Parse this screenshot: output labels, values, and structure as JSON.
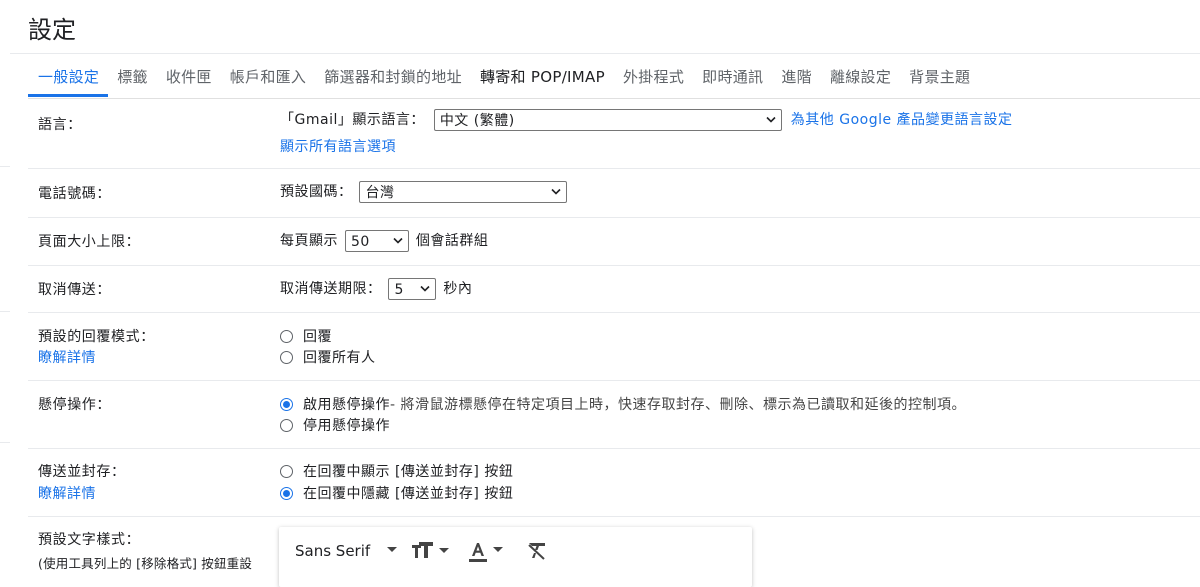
{
  "page": {
    "title": "設定"
  },
  "tabs": [
    {
      "label": "一般設定",
      "active": true
    },
    {
      "label": "標籤"
    },
    {
      "label": "收件匣"
    },
    {
      "label": "帳戶和匯入"
    },
    {
      "label": "篩選器和封鎖的地址"
    },
    {
      "label": "轉寄和 POP/IMAP",
      "plain": true
    },
    {
      "label": "外掛程式"
    },
    {
      "label": "即時通訊"
    },
    {
      "label": "進階"
    },
    {
      "label": "離線設定"
    },
    {
      "label": "背景主題"
    }
  ],
  "language": {
    "label": "語言：",
    "display_label": "「Gmail」顯示語言：",
    "value": "中文 (繁體)",
    "other_products_link": "為其他 Google 產品變更語言設定",
    "show_all_link": "顯示所有語言選項"
  },
  "phone": {
    "label": "電話號碼：",
    "country_label": "預設國碼：",
    "value": "台灣"
  },
  "page_size": {
    "label": "頁面大小上限：",
    "prefix": "每頁顯示",
    "value": "50",
    "suffix": "個會話群組"
  },
  "undo_send": {
    "label": "取消傳送：",
    "prefix": "取消傳送期限：",
    "value": "5",
    "suffix": "秒內"
  },
  "reply": {
    "label": "預設的回覆模式：",
    "learn_more": "瞭解詳情",
    "options": [
      "回覆",
      "回覆所有人"
    ],
    "selected": 0
  },
  "hover": {
    "label": "懸停操作：",
    "enable": "啟用懸停操作",
    "enable_desc": " - 將滑鼠游標懸停在特定項目上時，快速存取封存、刪除、標示為已讀取和延後的控制項。",
    "disable": "停用懸停操作"
  },
  "send_archive": {
    "label": "傳送並封存：",
    "learn_more": "瞭解詳情",
    "show": "在回覆中顯示 [傳送並封存] 按鈕",
    "hide": "在回覆中隱藏 [傳送並封存] 按鈕"
  },
  "text_style": {
    "label": "預設文字樣式：",
    "note": "(使用工具列上的 [移除格式] 按鈕重設",
    "font": "Sans Serif"
  },
  "colors": {
    "accent": "#1a73e8",
    "text": "#202124",
    "muted": "#5f6368",
    "divider": "#e8eaed"
  }
}
